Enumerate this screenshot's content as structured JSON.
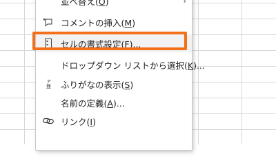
{
  "menu": {
    "items": [
      {
        "label_prefix": "並べ替え(",
        "mnemonic": "O",
        "label_suffix": ")",
        "icon": "",
        "has_submenu": true
      },
      {
        "label_prefix": "コメントの挿入(",
        "mnemonic": "M",
        "label_suffix": ")",
        "icon": "insert-comment-icon",
        "has_submenu": false
      },
      {
        "label_prefix": "セルの書式設定(",
        "mnemonic": "F",
        "label_suffix": ")...",
        "icon": "format-cells-icon",
        "has_submenu": false
      },
      {
        "label_prefix": "ドロップダウン リストから選択(",
        "mnemonic": "K",
        "label_suffix": ")...",
        "icon": "",
        "has_submenu": false
      },
      {
        "label_prefix": "ふりがなの表示(",
        "mnemonic": "S",
        "label_suffix": ")",
        "icon": "furigana-icon",
        "has_submenu": false
      },
      {
        "label_prefix": "名前の定義(",
        "mnemonic": "A",
        "label_suffix": ")...",
        "icon": "",
        "has_submenu": false
      },
      {
        "label_prefix": "リンク(",
        "mnemonic": "I",
        "label_suffix": ")",
        "icon": "link-icon",
        "has_submenu": false
      }
    ],
    "furigana_glyph": "ア亜",
    "submenu_arrow": "›"
  },
  "colors": {
    "highlight": "#f36f1a",
    "grid_line": "#d7d7d7"
  }
}
